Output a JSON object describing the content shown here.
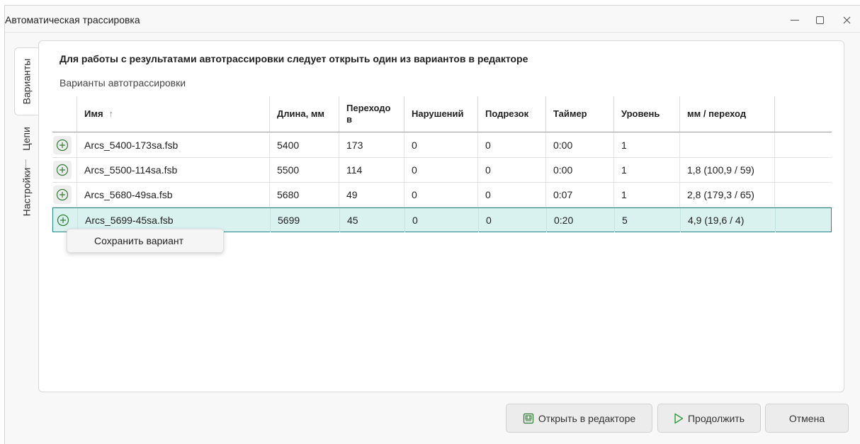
{
  "window": {
    "title": "Автоматическая трассировка"
  },
  "tabs": [
    {
      "label": "Варианты",
      "active": true
    },
    {
      "label": "Цепи",
      "active": false
    },
    {
      "label": "Настройки",
      "active": false
    }
  ],
  "panel": {
    "heading": "Для работы с результатами автотрассировки следует открыть один из вариантов в редакторе",
    "subheading": "Варианты автотрассировки"
  },
  "table": {
    "columns": [
      "Имя",
      "Длина, мм",
      "Переходо\nв",
      "Нарушений",
      "Подрезок",
      "Таймер",
      "Уровень",
      "мм / переход"
    ],
    "sort_icon": "arrow-up-icon",
    "rows": [
      {
        "name": "Arcs_5400-173sa.fsb",
        "length": "5400",
        "vias": "173",
        "violations": "0",
        "cuts": "0",
        "timer": "0:00",
        "level": "1",
        "mm_per_via": "",
        "selected": false
      },
      {
        "name": "Arcs_5500-114sa.fsb",
        "length": "5500",
        "vias": "114",
        "violations": "0",
        "cuts": "0",
        "timer": "0:00",
        "level": "1",
        "mm_per_via": "1,8 (100,9 / 59)",
        "selected": false
      },
      {
        "name": "Arcs_5680-49sa.fsb",
        "length": "5680",
        "vias": "49",
        "violations": "0",
        "cuts": "0",
        "timer": "0:07",
        "level": "1",
        "mm_per_via": "2,8 (179,3 / 65)",
        "selected": false
      },
      {
        "name": "Arcs_5699-45sa.fsb",
        "length": "5699",
        "vias": "45",
        "violations": "0",
        "cuts": "0",
        "timer": "0:20",
        "level": "5",
        "mm_per_via": "4,9 (19,6 / 4)",
        "selected": true
      }
    ]
  },
  "context_menu": {
    "item": "Сохранить вариант"
  },
  "buttons": {
    "open_editor": "Открыть в редакторе",
    "continue": "Продолжить",
    "cancel": "Отмена"
  },
  "colors": {
    "accent": "#21867f",
    "selected_row": "#d9f1ef",
    "plus_icon": "#2e7d32"
  }
}
